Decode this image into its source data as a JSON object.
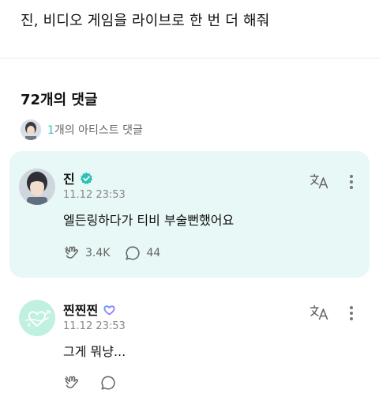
{
  "post": {
    "title": "진, 비디오 게임을 라이브로 한 번 더 해줘"
  },
  "comments_header": {
    "count_label": "72개의 댓글"
  },
  "artist_comments": {
    "count": "1",
    "label_suffix": "개의 아티스트 댓글"
  },
  "comments": [
    {
      "author": "진",
      "badge_icon": "verified-check-icon",
      "timestamp": "11.12 23:53",
      "text": "엘든링하다가 티비 부술뻔했어요",
      "likes": "3.4K",
      "replies": "44",
      "is_artist": true
    },
    {
      "author": "찐찐찐",
      "badge_icon": "heart-membership-icon",
      "timestamp": "11.12 23:53",
      "text": "그게 뭐냥...",
      "likes": "",
      "replies": "",
      "is_artist": false
    }
  ],
  "colors": {
    "accent": "#2fc0b6",
    "artist_card_bg": "#e8f8f6",
    "muted": "#888888"
  }
}
